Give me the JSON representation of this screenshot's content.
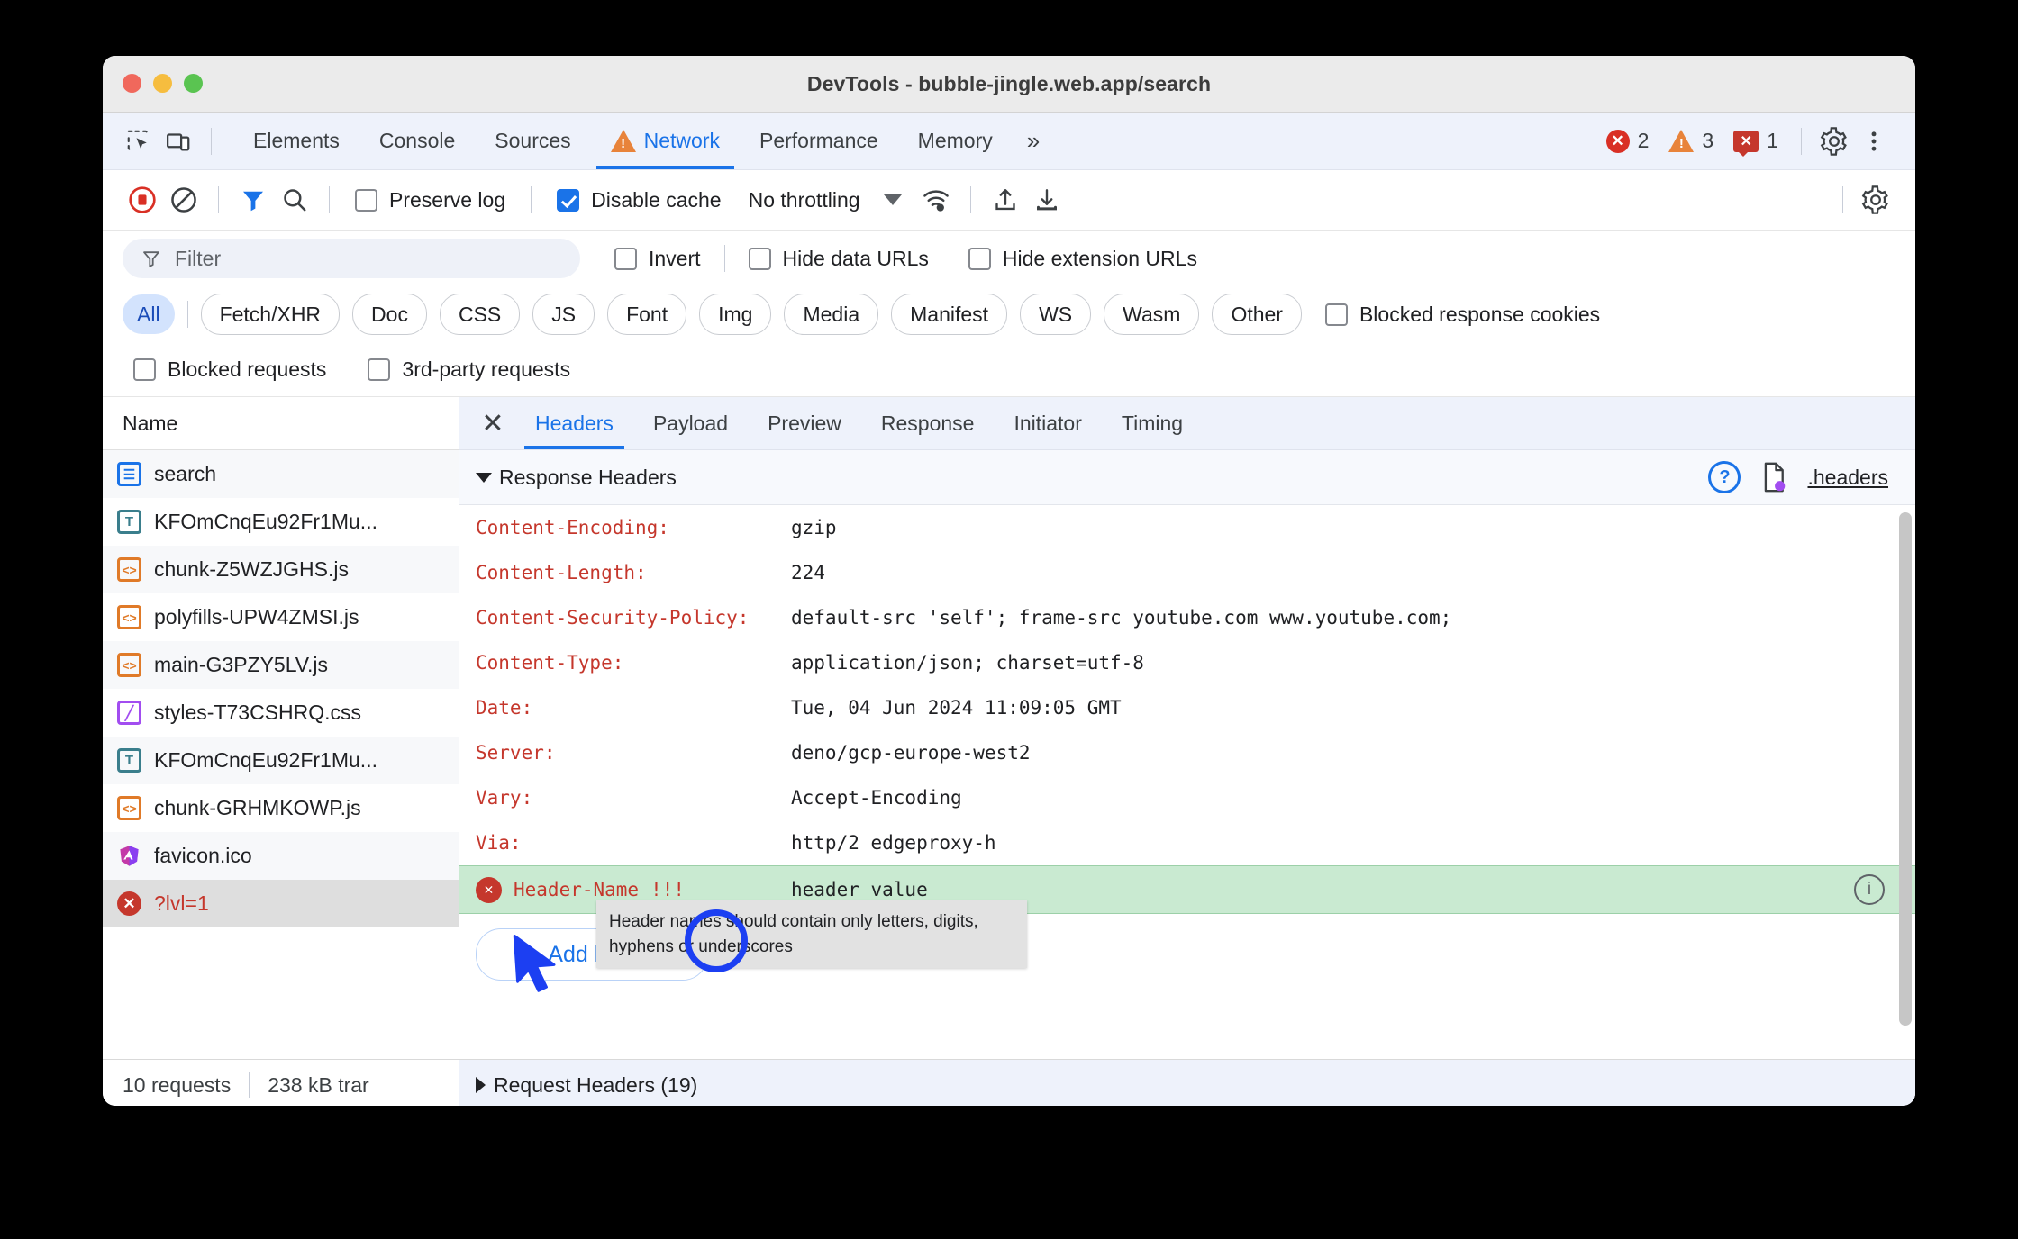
{
  "window": {
    "title": "DevTools - bubble-jingle.web.app/search",
    "traffic_lights": [
      "close",
      "minimize",
      "zoom"
    ]
  },
  "main_tabbar": {
    "icons": [
      {
        "name": "inspect-element-icon"
      },
      {
        "name": "device-toolbar-icon"
      }
    ],
    "tabs": [
      {
        "label": "Elements",
        "active": false,
        "warning": false
      },
      {
        "label": "Console",
        "active": false,
        "warning": false
      },
      {
        "label": "Sources",
        "active": false,
        "warning": false
      },
      {
        "label": "Network",
        "active": true,
        "warning": true
      },
      {
        "label": "Performance",
        "active": false,
        "warning": false
      },
      {
        "label": "Memory",
        "active": false,
        "warning": false
      }
    ],
    "more_tabs_label": "»",
    "counters": {
      "errors": "2",
      "warnings": "3",
      "issues": "1"
    },
    "settings_label": "gear-icon",
    "more_label": "kebab-menu-icon"
  },
  "network_toolbar": {
    "record_label": "record-button",
    "clear_label": "clear-button",
    "filter_toggle_label": "filter-icon",
    "search_label": "search-icon",
    "preserve_log": {
      "label": "Preserve log",
      "checked": false
    },
    "disable_cache": {
      "label": "Disable cache",
      "checked": true
    },
    "throttling": {
      "value": "No throttling"
    },
    "network_conditions_label": "network-conditions-icon",
    "import_label": "import-har-icon",
    "export_label": "export-har-icon",
    "settings_label": "network-settings-gear-icon"
  },
  "filter_row": {
    "filter_placeholder": "Filter",
    "filter_value": "",
    "invert": {
      "label": "Invert",
      "checked": false
    },
    "hide_data_urls": {
      "label": "Hide data URLs",
      "checked": false
    },
    "hide_extension_urls": {
      "label": "Hide extension URLs",
      "checked": false
    }
  },
  "type_chips": [
    {
      "label": "All",
      "active": true
    },
    {
      "label": "Fetch/XHR",
      "active": false
    },
    {
      "label": "Doc",
      "active": false
    },
    {
      "label": "CSS",
      "active": false
    },
    {
      "label": "JS",
      "active": false
    },
    {
      "label": "Font",
      "active": false
    },
    {
      "label": "Img",
      "active": false
    },
    {
      "label": "Media",
      "active": false
    },
    {
      "label": "Manifest",
      "active": false
    },
    {
      "label": "WS",
      "active": false
    },
    {
      "label": "Wasm",
      "active": false
    },
    {
      "label": "Other",
      "active": false
    }
  ],
  "chip_checkboxes": {
    "blocked_response_cookies": {
      "label": "Blocked response cookies",
      "checked": false
    },
    "blocked_requests": {
      "label": "Blocked requests",
      "checked": false
    },
    "third_party_requests": {
      "label": "3rd-party requests",
      "checked": false
    }
  },
  "requests_panel": {
    "column_header": "Name",
    "rows": [
      {
        "name": "search",
        "icon": "doc",
        "selected": false
      },
      {
        "name": "KFOmCnqEu92Fr1Mu...",
        "icon": "font",
        "selected": false
      },
      {
        "name": "chunk-Z5WZJGHS.js",
        "icon": "js",
        "selected": false
      },
      {
        "name": "polyfills-UPW4ZMSI.js",
        "icon": "js",
        "selected": false
      },
      {
        "name": "main-G3PZY5LV.js",
        "icon": "js",
        "selected": false
      },
      {
        "name": "styles-T73CSHRQ.css",
        "icon": "css",
        "selected": false
      },
      {
        "name": "KFOmCnqEu92Fr1Mu...",
        "icon": "font",
        "selected": false
      },
      {
        "name": "chunk-GRHMKOWP.js",
        "icon": "js",
        "selected": false
      },
      {
        "name": "favicon.ico",
        "icon": "favicon",
        "selected": false
      },
      {
        "name": "?lvl=1",
        "icon": "err",
        "selected": true
      }
    ]
  },
  "detail_panel": {
    "close_label": "✕",
    "tabs": [
      {
        "label": "Headers",
        "active": true
      },
      {
        "label": "Payload",
        "active": false
      },
      {
        "label": "Preview",
        "active": false
      },
      {
        "label": "Response",
        "active": false
      },
      {
        "label": "Initiator",
        "active": false
      },
      {
        "label": "Timing",
        "active": false
      }
    ],
    "response_headers": {
      "section_title": "Response Headers",
      "expanded": true,
      "help_label": "?",
      "override_file": ".headers",
      "override_icon": "headers-file-icon",
      "rows": [
        {
          "name": "Content-Encoding:",
          "value": "gzip"
        },
        {
          "name": "Content-Length:",
          "value": "224"
        },
        {
          "name": "Content-Security-Policy:",
          "value": "default-src 'self'; frame-src youtube.com www.youtube.com;"
        },
        {
          "name": "Content-Type:",
          "value": "application/json; charset=utf-8"
        },
        {
          "name": "Date:",
          "value": "Tue, 04 Jun 2024 11:09:05 GMT"
        },
        {
          "name": "Server:",
          "value": "deno/gcp-europe-west2"
        },
        {
          "name": "Vary:",
          "value": "Accept-Encoding"
        },
        {
          "name": "Via:",
          "value": "http/2 edgeproxy-h"
        }
      ],
      "editable_row": {
        "name": "Header-Name",
        "invalid_suffix": "!!!",
        "value": "header value",
        "error_icon": "error-icon",
        "info_icon": "info-icon"
      },
      "add_header_label": "Add header"
    },
    "tooltip": "Header names should contain only letters, digits, hyphens or underscores",
    "request_headers": {
      "section_title": "Request Headers (19)",
      "expanded": false
    }
  },
  "footer": {
    "requests": "10 requests",
    "transferred": "238 kB trar"
  }
}
